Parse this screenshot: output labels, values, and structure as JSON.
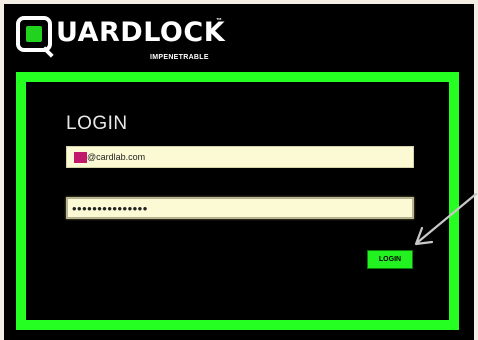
{
  "brand": {
    "name": "UARDLOCK",
    "trademark": "™",
    "tagline": "IMPENETRABLE",
    "accent_color": "#25ff22"
  },
  "login": {
    "title": "LOGIN",
    "email_value": "@cardlab.com",
    "password_value": "•••••••••••••••",
    "button_label": "LOGIN"
  },
  "annotation": {
    "arrow_icon": "arrow-pointing-to-login-button"
  }
}
